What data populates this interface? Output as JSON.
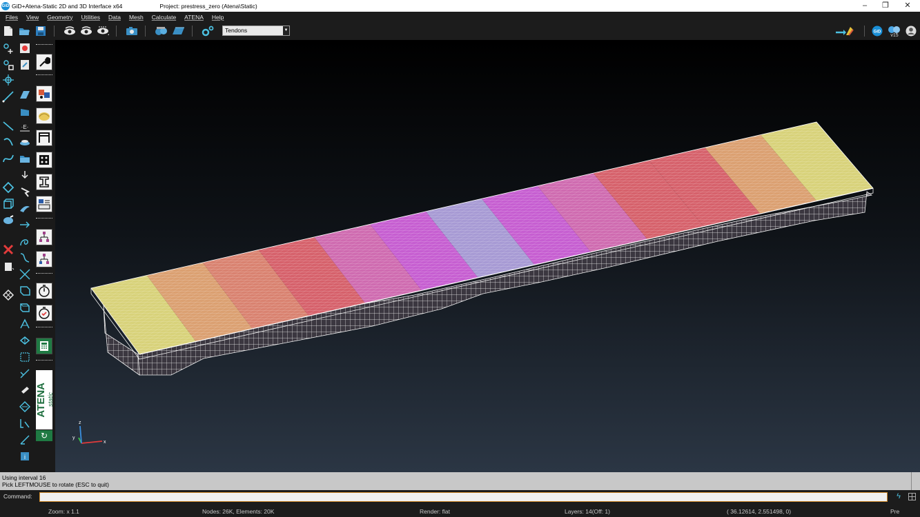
{
  "window": {
    "title": "GiD+Atena-Static 2D and 3D Interface x64",
    "project": "Project: prestress_zero (Atena\\Static)",
    "minimize_glyph": "–",
    "restore_glyph": "❐",
    "close_glyph": "✕"
  },
  "menu": {
    "items": [
      "Files",
      "View",
      "Geometry",
      "Utilities",
      "Data",
      "Mesh",
      "Calculate",
      "ATENA",
      "Help"
    ]
  },
  "toolbar": {
    "render_select_value": "Tendons",
    "version_badge": "v15",
    "gid_badge": "GiD"
  },
  "atena_panel": {
    "logo_main": "ATENA",
    "logo_sub": "static"
  },
  "viewport": {
    "axis_x": "x",
    "axis_y": "y",
    "axis_z": "z"
  },
  "messages": {
    "line1": "Using interval 16",
    "line2": "Pick LEFTMOUSE to rotate (ESC to quit)"
  },
  "command": {
    "label": "Command:",
    "value": ""
  },
  "status": {
    "zoom": "Zoom: x 1.1",
    "nodes_elements": "Nodes: 26K, Elements: 20K",
    "render": "Render: flat",
    "layers": "Layers: 14(Off: 1)",
    "coordinates": "( 36.12614,  2.551498,  0)",
    "pre": "Pre"
  },
  "colors": {
    "band_yellow": "#d8d27a",
    "band_orange": "#dba071",
    "band_salmon": "#d98270",
    "band_red": "#d6616b",
    "band_pink": "#cf6bb0",
    "band_magenta": "#c65ed1",
    "band_lavender": "#a79ad4",
    "atena_green": "#1f7a43"
  }
}
